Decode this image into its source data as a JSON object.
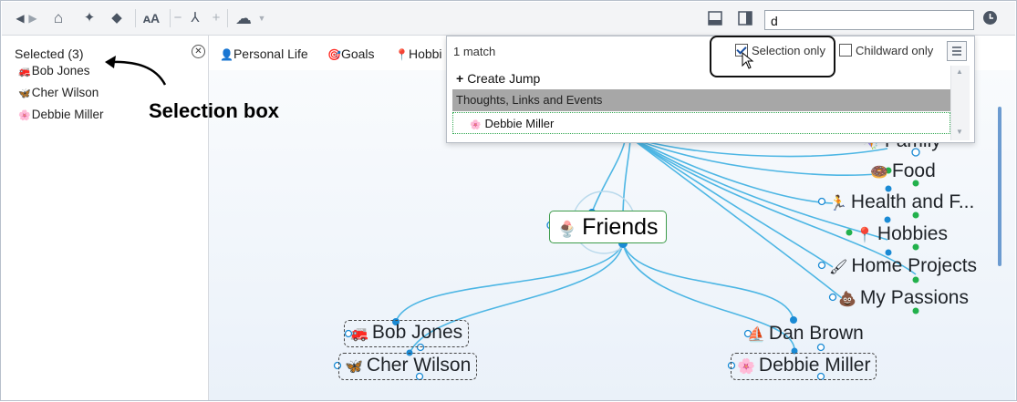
{
  "toolbar": {
    "search_value": "d",
    "icons": [
      "back-icon",
      "forward-icon",
      "home-icon",
      "pin-icon",
      "tag-icon",
      "font-size-icon",
      "minus-icon",
      "layout-icon",
      "plus-icon",
      "cloud-icon",
      "split-horizontal-icon",
      "split-vertical-icon",
      "clock-icon"
    ]
  },
  "sidebar": {
    "title": "Selected (3)",
    "items": [
      {
        "label": "Bob Jones",
        "icon": "fire-truck-icon"
      },
      {
        "label": "Cher Wilson",
        "icon": "butterfly-icon"
      },
      {
        "label": "Debbie Miller",
        "icon": "flower-icon"
      }
    ]
  },
  "annotation": {
    "label": "Selection box"
  },
  "tabs": [
    {
      "label": "Personal Life",
      "icon": "person-icon"
    },
    {
      "label": "Goals",
      "icon": "target-icon"
    },
    {
      "label": "Hobbi",
      "icon": "pin-icon"
    }
  ],
  "dropdown": {
    "match_count": "1 match",
    "selection_only": {
      "label": "Selection only",
      "checked": true
    },
    "childward_only": {
      "label": "Childward only",
      "checked": false
    },
    "create_jump": "Create Jump",
    "section_header": "Thoughts, Links and Events",
    "result": "Debbie Miller"
  },
  "map": {
    "center": "Friends",
    "right_nodes": [
      {
        "label": "Family",
        "icon": "kite-icon"
      },
      {
        "label": "Food",
        "icon": "donut-icon"
      },
      {
        "label": "Health and F...",
        "icon": "runner-icon"
      },
      {
        "label": "Hobbies",
        "icon": "pin-icon"
      },
      {
        "label": "Home Projects",
        "icon": "paint-roller-icon"
      },
      {
        "label": "My Passions",
        "icon": "poop-icon"
      }
    ],
    "children": [
      {
        "label": "Bob Jones",
        "icon": "fire-truck-icon",
        "selected": true
      },
      {
        "label": "Cher Wilson",
        "icon": "butterfly-icon",
        "selected": true
      },
      {
        "label": "Dan Brown",
        "icon": "boat-icon",
        "selected": false
      },
      {
        "label": "Debbie Miller",
        "icon": "flower-icon",
        "selected": true
      }
    ]
  },
  "colors": {
    "link": "#4db6e4",
    "center_border": "#3d9c4a",
    "accent_blue": "#1a8ad4",
    "green_dot": "#22b14c"
  }
}
